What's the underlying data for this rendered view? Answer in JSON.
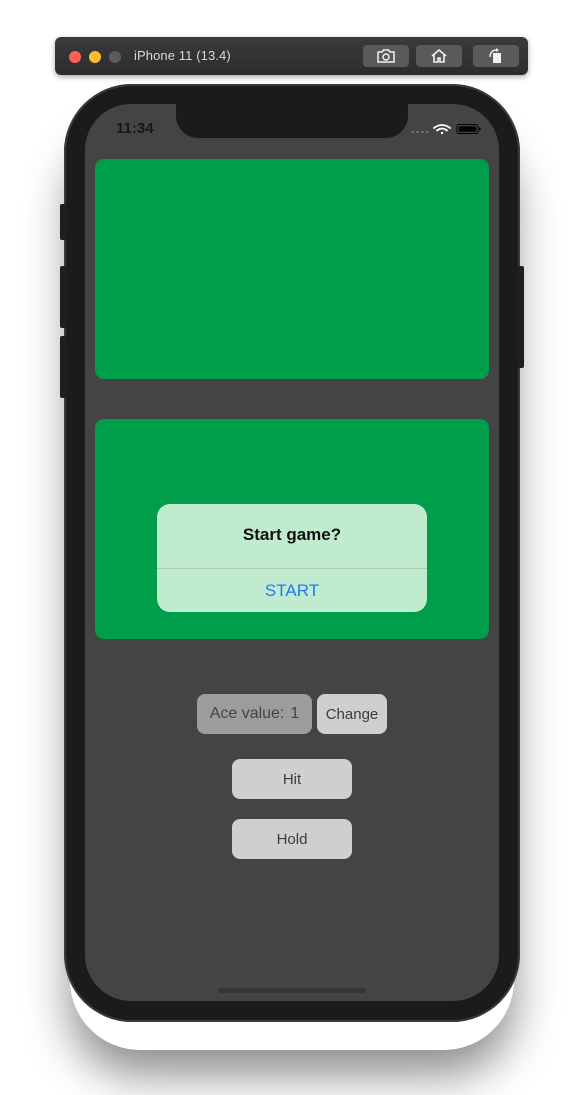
{
  "simulator": {
    "title": "iPhone 11 (13.4)",
    "toolbar_icons": [
      "screenshot-icon",
      "home-icon",
      "rotate-icon"
    ]
  },
  "status_bar": {
    "time": "11:34"
  },
  "colors": {
    "table_green": "#009e4a",
    "screen_bg": "#444444",
    "alert_link": "#1f7bf6"
  },
  "alert": {
    "title": "Start game?",
    "action_label": "START"
  },
  "controls": {
    "ace_label": "Ace value:",
    "ace_value": "1",
    "change_label": "Change",
    "hit_label": "Hit",
    "hold_label": "Hold"
  }
}
